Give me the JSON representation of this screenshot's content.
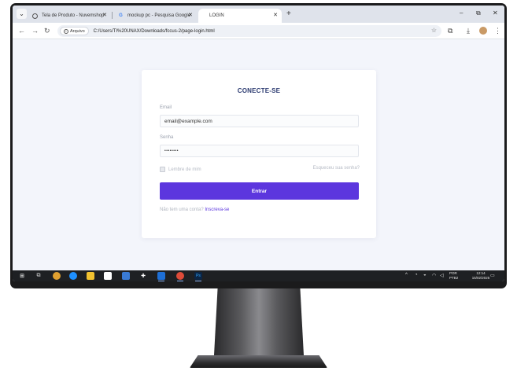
{
  "browser": {
    "tabs": [
      {
        "label": "Tela de Produto - Nuvemshop",
        "active": false
      },
      {
        "label": "mockup pc - Pesquisa Google",
        "active": false
      },
      {
        "label": "LOGIN",
        "active": true
      }
    ],
    "new_tab": "+",
    "window_controls": {
      "minimize": "–",
      "maximize": "⧉",
      "close": "✕"
    },
    "address": {
      "chip_label": "Arquivo",
      "url": "C:/Users/TI%20UNAX/Downloads/fccus-2/page-login.html"
    }
  },
  "login": {
    "title": "CONECTE-SE",
    "email_label": "Email",
    "email_value": "email@example.com",
    "password_label": "Senha",
    "password_value": "••••••••",
    "remember_label": "Lembre de mim",
    "forgot_label": "Esqueceu sua senha?",
    "submit_label": "Entrar",
    "signup_prompt": "Não tem uma conta?",
    "signup_link": "Inscreva-se"
  },
  "taskbar": {
    "language": "POR",
    "layout": "PTB2",
    "time": "12:14",
    "date": "15/02/2025"
  },
  "colors": {
    "accent": "#5c36de",
    "title": "#2b3a70",
    "page_background": "#f3f5fb"
  }
}
